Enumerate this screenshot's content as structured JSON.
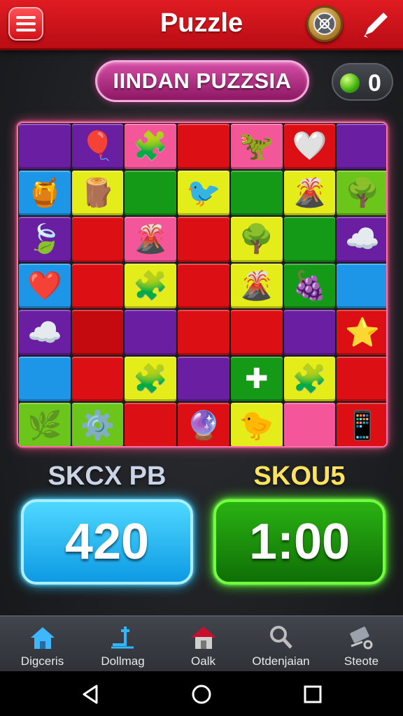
{
  "header": {
    "title": "Puzzle",
    "menu_icon": "hamburger-menu-icon",
    "coin_icon": "settings-coin-icon",
    "edit_icon": "pencil-icon"
  },
  "subheader": {
    "title": "IINDAN PUZZSIA",
    "gem_count": "0",
    "gem_icon": "green-gem-icon"
  },
  "board": {
    "rows": 7,
    "cols": 7,
    "cells": [
      [
        "purple",
        "purple:🎈",
        "pink:🧩",
        "red",
        "pink:🦖",
        "red:🤍",
        "purple"
      ],
      [
        "blue:🍯",
        "yellow:🪵",
        "green",
        "yellow:🐦",
        "green",
        "yellow:🌋",
        "lime:🌳"
      ],
      [
        "purple:🍃",
        "red",
        "pink:🌋",
        "red",
        "yellow:🌳",
        "green",
        "purple:☁️"
      ],
      [
        "blue:❤️",
        "red",
        "yellow:🧩",
        "red",
        "yellow:🌋",
        "green:🍇",
        "blue"
      ],
      [
        "purple:☁️",
        "darkred",
        "purple",
        "red",
        "red",
        "purple",
        "red:⭐"
      ],
      [
        "blue",
        "red",
        "yellow:🧩",
        "purple",
        "green:✚",
        "yellow:🧩",
        "red"
      ],
      [
        "lime:🌿",
        "lime:⚙️",
        "red",
        "red:🔮",
        "yellow:🐤",
        "pink",
        "red:📱"
      ]
    ]
  },
  "scores": {
    "left_label": "SKCX PB",
    "left_value": "420",
    "right_label": "SKOU5",
    "right_value": "1:00"
  },
  "nav": [
    {
      "label": "Digceris",
      "icon": "home-icon",
      "color": "#3fb7ff"
    },
    {
      "label": "Dollmag",
      "icon": "pipe-icon",
      "color": "#2fb7ff"
    },
    {
      "label": "Oalk",
      "icon": "house-icon",
      "color": "#c9c9c9"
    },
    {
      "label": "Otdenjaian",
      "icon": "search-icon",
      "color": "#c9c9c9"
    },
    {
      "label": "Steote",
      "icon": "tools-icon",
      "color": "#c9c9c9"
    }
  ],
  "system_nav": [
    "back-icon",
    "home-circle-icon",
    "recents-icon"
  ]
}
